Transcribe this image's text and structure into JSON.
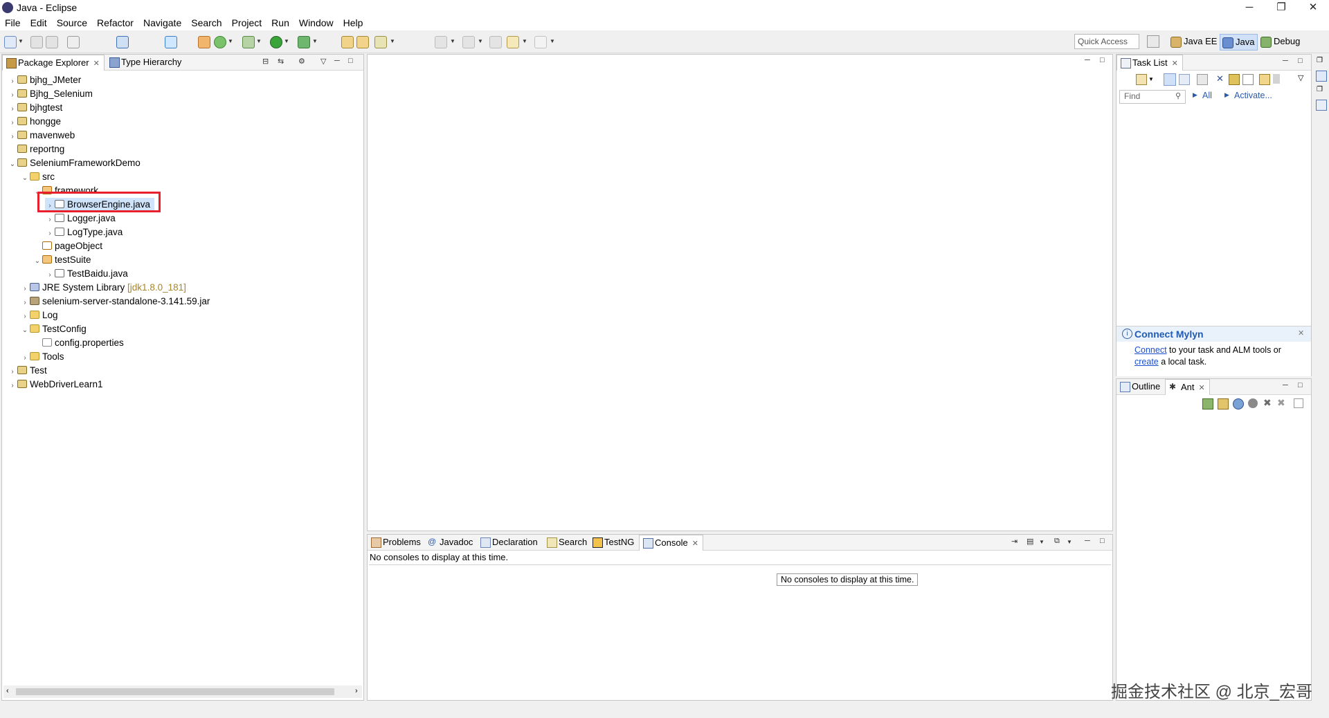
{
  "window": {
    "title": "Java - Eclipse",
    "controls": {
      "minimize": "─",
      "restore": "❐",
      "close": "✕"
    }
  },
  "menu": [
    "File",
    "Edit",
    "Source",
    "Refactor",
    "Navigate",
    "Search",
    "Project",
    "Run",
    "Window",
    "Help"
  ],
  "toolbar": {
    "quick_access_placeholder": "Quick Access",
    "perspectives": [
      "Java EE",
      "Java",
      "Debug"
    ],
    "active_perspective": "Java"
  },
  "package_explorer": {
    "tabs": [
      {
        "label": "Package Explorer",
        "active": true,
        "closable": true
      },
      {
        "label": "Type Hierarchy",
        "active": false,
        "closable": false
      }
    ],
    "tree": [
      {
        "label": "bjhg_JMeter",
        "icon": "project-icon",
        "twisty": "›"
      },
      {
        "label": "Bjhg_Selenium",
        "icon": "project-icon",
        "twisty": "›"
      },
      {
        "label": "bjhgtest",
        "icon": "project-icon",
        "twisty": "›"
      },
      {
        "label": "hongge",
        "icon": "project-icon",
        "twisty": "›"
      },
      {
        "label": "mavenweb",
        "icon": "project-icon",
        "twisty": "›"
      },
      {
        "label": "reportng",
        "icon": "project-icon",
        "twisty": ""
      },
      {
        "label": "SeleniumFrameworkDemo",
        "icon": "project-icon",
        "twisty": "⌄"
      },
      {
        "label": "src",
        "icon": "folder-icon",
        "twisty": "⌄"
      },
      {
        "label": "framework",
        "icon": "package-icon",
        "twisty": "⌄"
      },
      {
        "label": "BrowserEngine.java",
        "icon": "java-file-icon",
        "twisty": "›",
        "selected": true
      },
      {
        "label": "Logger.java",
        "icon": "java-file-icon",
        "twisty": "›"
      },
      {
        "label": "LogType.java",
        "icon": "java-file-icon",
        "twisty": "›"
      },
      {
        "label": "pageObject",
        "icon": "package-icon",
        "twisty": ""
      },
      {
        "label": "testSuite",
        "icon": "package-icon",
        "twisty": "⌄"
      },
      {
        "label": "TestBaidu.java",
        "icon": "java-file-icon",
        "twisty": "›"
      },
      {
        "label": "JRE System Library",
        "decoration": "[jdk1.8.0_181]",
        "icon": "library-icon",
        "twisty": "›"
      },
      {
        "label": "selenium-server-standalone-3.141.59.jar",
        "icon": "jar-icon",
        "twisty": "›"
      },
      {
        "label": "Log",
        "icon": "folder-icon",
        "twisty": "›"
      },
      {
        "label": "TestConfig",
        "icon": "folder-icon",
        "twisty": "⌄"
      },
      {
        "label": "config.properties",
        "icon": "properties-file-icon",
        "twisty": ""
      },
      {
        "label": "Tools",
        "icon": "folder-icon",
        "twisty": "›"
      },
      {
        "label": "Test",
        "icon": "project-icon",
        "twisty": "›"
      },
      {
        "label": "WebDriverLearn1",
        "icon": "project-icon",
        "twisty": "›"
      }
    ]
  },
  "task_list": {
    "tab_label": "Task List",
    "find_placeholder": "Find",
    "all_label": "All",
    "activate_label": "Activate...",
    "mylyn": {
      "title": "Connect Mylyn",
      "connect_link": "Connect",
      "text1": " to your task and ALM tools or",
      "create_link": "create",
      "text2": " a local task."
    }
  },
  "outline": {
    "tabs": [
      {
        "label": "Outline",
        "active": false,
        "closable": false
      },
      {
        "label": "Ant",
        "active": true,
        "closable": true
      }
    ]
  },
  "bottom": {
    "tabs": [
      {
        "label": "Problems",
        "active": false
      },
      {
        "label": "Javadoc",
        "active": false
      },
      {
        "label": "Declaration",
        "active": false
      },
      {
        "label": "Search",
        "active": false
      },
      {
        "label": "TestNG",
        "active": false
      },
      {
        "label": "Console",
        "active": true
      }
    ],
    "console_header": "No consoles to display at this time.",
    "console_center": "No consoles to display at this time."
  },
  "watermark": "掘金技术社区 @ 北京_宏哥"
}
